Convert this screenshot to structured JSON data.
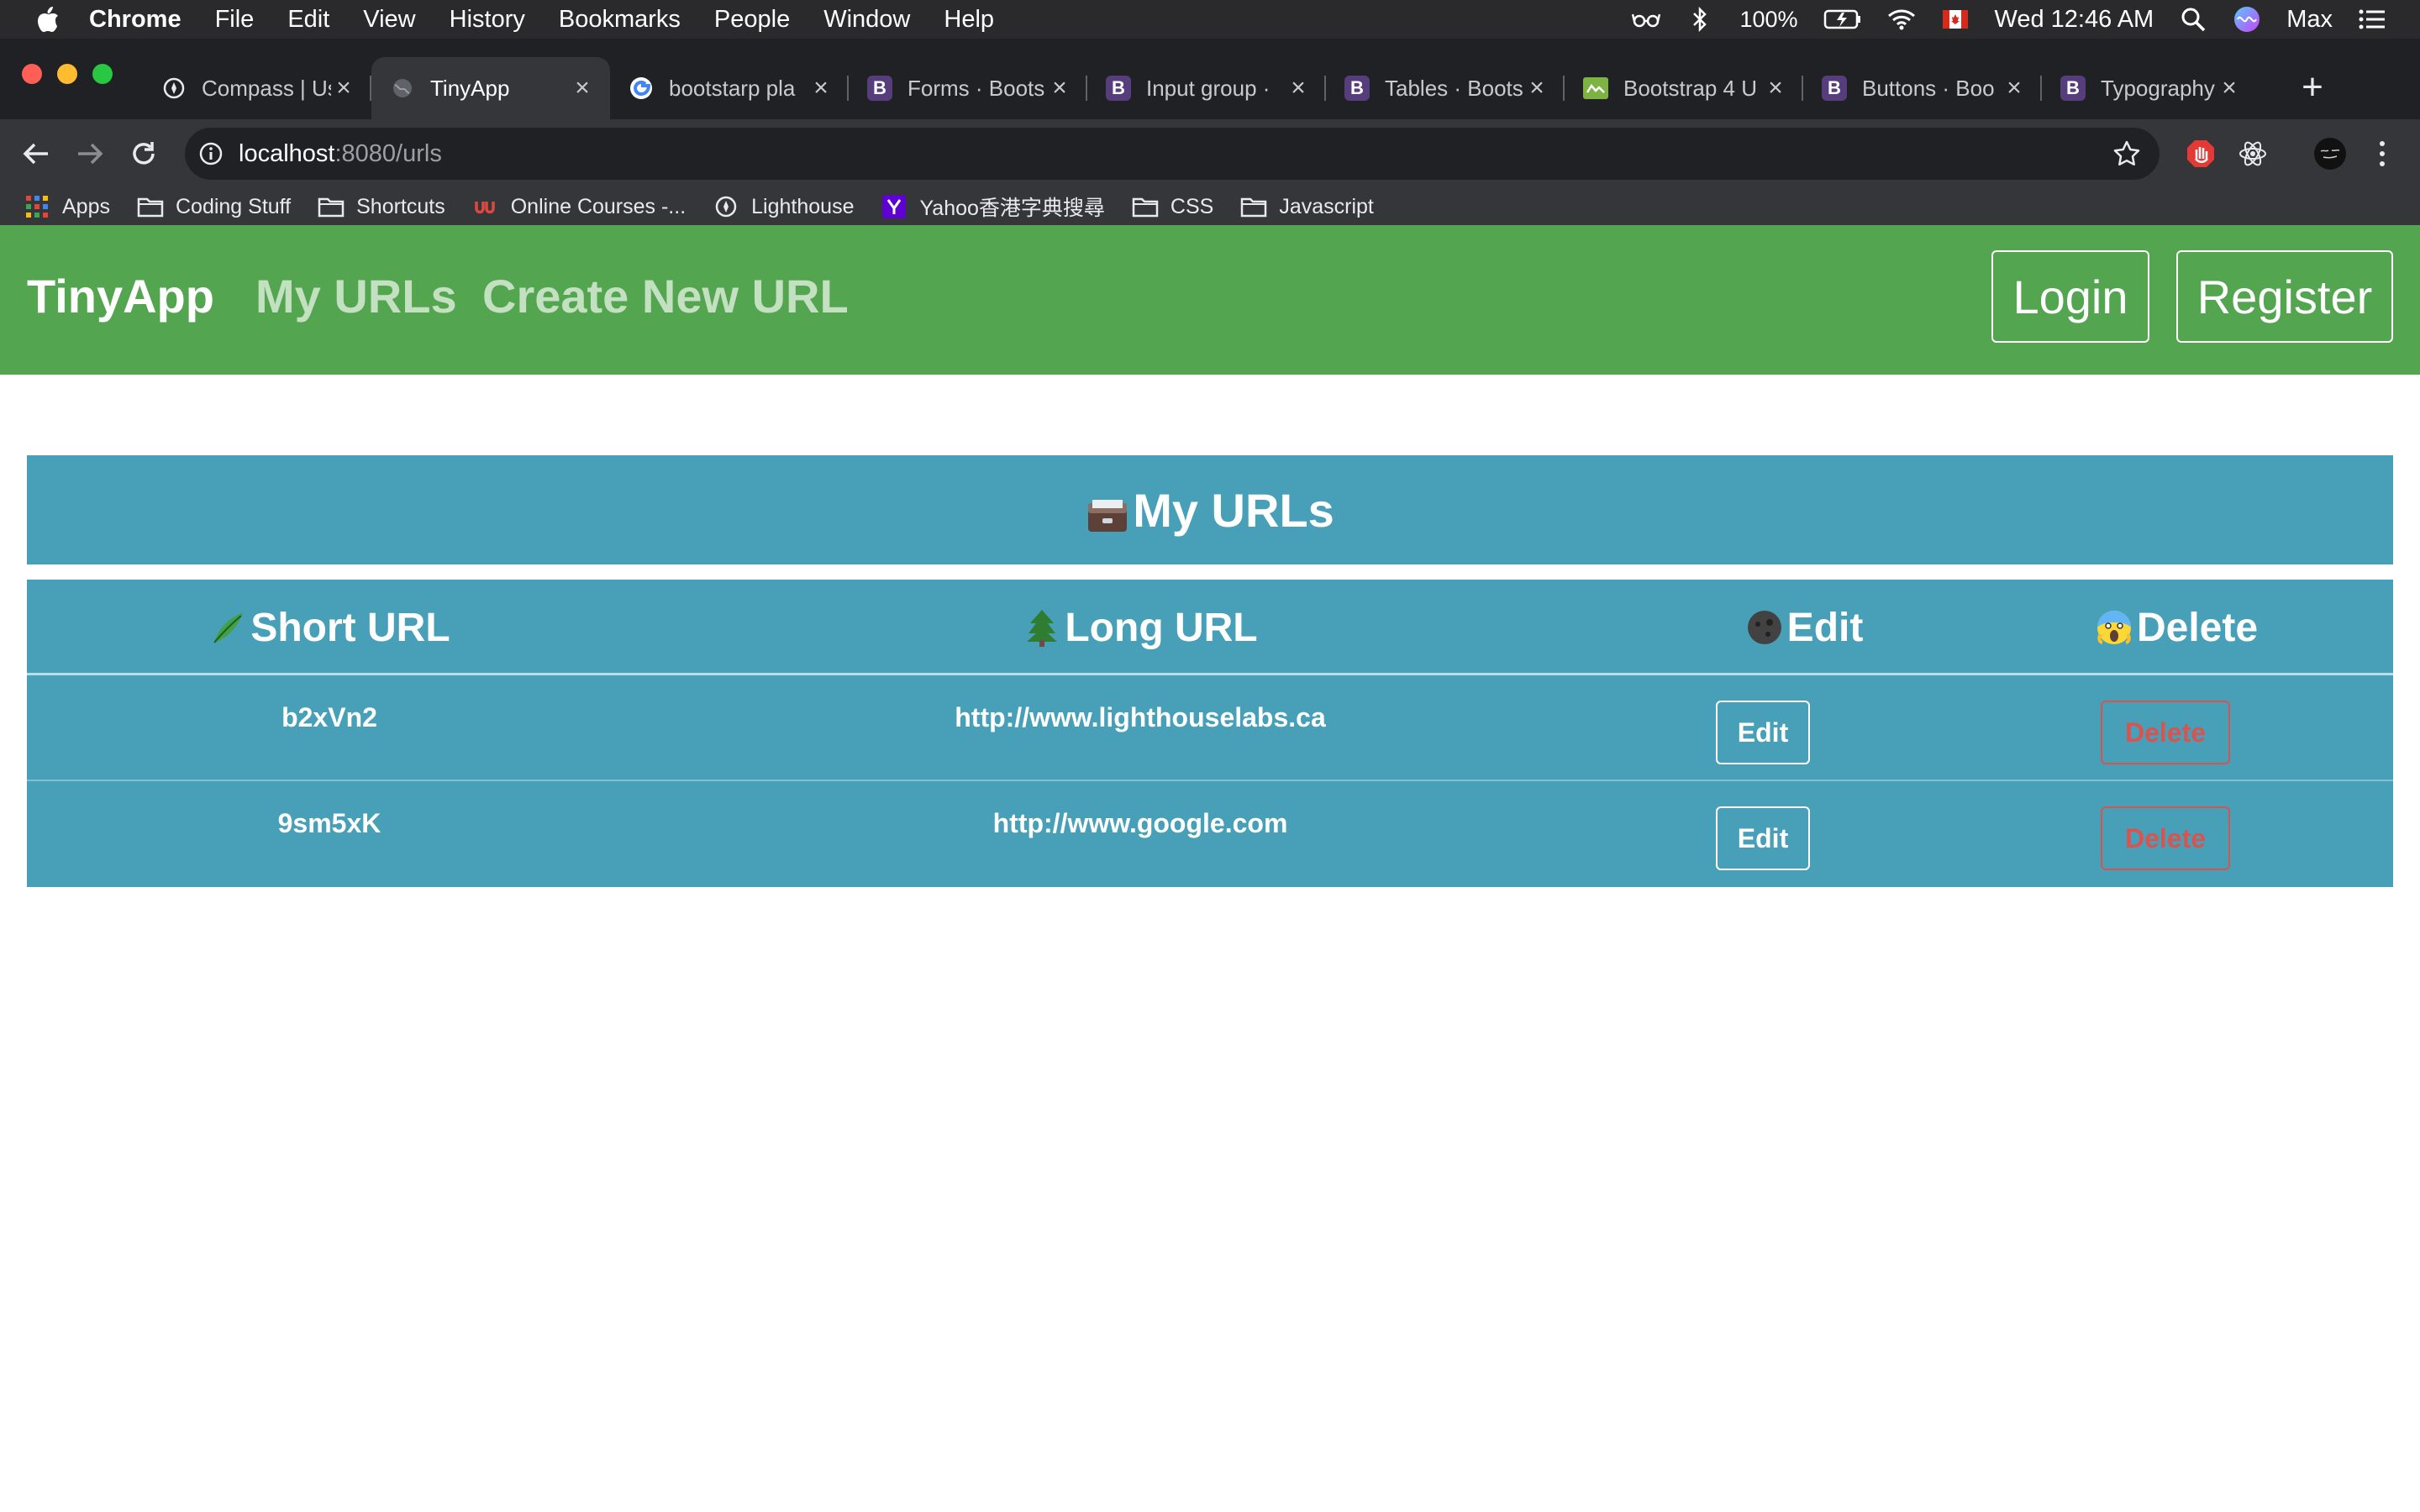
{
  "menubar": {
    "items": [
      "Chrome",
      "File",
      "Edit",
      "View",
      "History",
      "Bookmarks",
      "People",
      "Window",
      "Help"
    ],
    "battery": "100%",
    "clock": "Wed 12:46 AM",
    "user": "Max"
  },
  "tabs": [
    {
      "title": "Compass | Us",
      "favicon": "compass-icon"
    },
    {
      "title": "TinyApp",
      "favicon": "globe-icon",
      "active": true
    },
    {
      "title": "bootstarp pla",
      "favicon": "google-icon"
    },
    {
      "title": "Forms · Boots",
      "favicon": "bootstrap-icon"
    },
    {
      "title": "Input group · ",
      "favicon": "bootstrap-icon"
    },
    {
      "title": "Tables · Boots",
      "favicon": "bootstrap-icon"
    },
    {
      "title": "Bootstrap 4 U",
      "favicon": "bootstrap-build-icon"
    },
    {
      "title": "Buttons · Boo",
      "favicon": "bootstrap-icon"
    },
    {
      "title": "Typography · ",
      "favicon": "bootstrap-icon"
    }
  ],
  "address": {
    "host": "localhost",
    "path": ":8080/urls"
  },
  "bookmarks": [
    {
      "label": "Apps",
      "icon": "apps-grid-icon"
    },
    {
      "label": "Coding Stuff",
      "icon": "folder-icon"
    },
    {
      "label": "Shortcuts",
      "icon": "folder-icon"
    },
    {
      "label": "Online Courses -...",
      "icon": "udemy-icon"
    },
    {
      "label": "Lighthouse",
      "icon": "compass-icon"
    },
    {
      "label": "Yahoo香港字典搜尋",
      "icon": "yahoo-icon"
    },
    {
      "label": "CSS",
      "icon": "folder-icon"
    },
    {
      "label": "Javascript",
      "icon": "folder-icon"
    }
  ],
  "navbar": {
    "brand": "TinyApp",
    "links": [
      "My URLs",
      "Create New URL"
    ],
    "login": "Login",
    "register": "Register"
  },
  "page": {
    "title": "My URLs",
    "columns": [
      "Short URL",
      "Long URL",
      "Edit",
      "Delete"
    ],
    "rows": [
      {
        "short": "b2xVn2",
        "long": "http://www.lighthouselabs.ca",
        "edit": "Edit",
        "delete": "Delete"
      },
      {
        "short": "9sm5xK",
        "long": "http://www.google.com",
        "edit": "Edit",
        "delete": "Delete"
      }
    ]
  },
  "colors": {
    "navbar": "#54a550",
    "panel": "#47a0b8",
    "danger": "#d9534f"
  }
}
